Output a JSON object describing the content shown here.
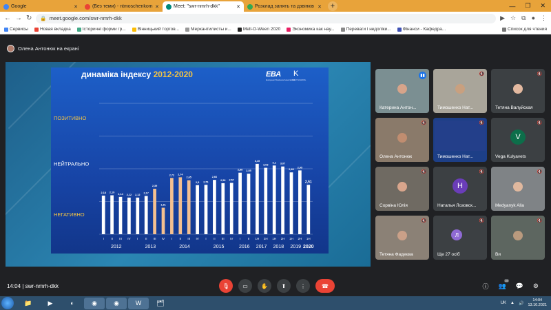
{
  "browser": {
    "tabs": [
      {
        "label": "Google",
        "color": "#4285f4",
        "active": false
      },
      {
        "label": "(Без теми) - ntmoschenkom@...",
        "color": "#ea4335",
        "active": false
      },
      {
        "label": "Meet: \"swr-nmrh-dkk\"",
        "color": "#00897b",
        "active": true
      },
      {
        "label": "Розклад занять та дзвінків | \"Е...",
        "color": "#34a853",
        "active": false
      }
    ],
    "new_tab": "+",
    "url": "meet.google.com/swr-nmrh-dkk",
    "bookmarks": [
      "Сервисы",
      "Новая вкладка",
      "Історичні форми гр...",
      "Вінницький торгов...",
      "Меркантилисты и...",
      "Mell-O-Ween 2020",
      "Экономика как нау...",
      "Переваги і недоліки...",
      "Фінанси - Кафедра..."
    ],
    "reading_list": "Список для чтения"
  },
  "meet": {
    "presenter_label": "Олена Антонюк на екрані",
    "meeting_time": "14:04",
    "meeting_code": "swr-nmrh-dkk",
    "participants_count": "39",
    "end_call_color": "#ea4335",
    "accent": "#1a73e8"
  },
  "slide": {
    "title_main": "динаміка індексу",
    "title_years": "2012-2020",
    "logo_eba": "EBA",
    "logo_eba_sub": "European Business Association",
    "logo_k": "K",
    "logo_k_sub": "KIEV SCHOOL"
  },
  "chart_data": {
    "type": "bar",
    "bands": [
      "ПОЗИТИВНО",
      "НЕЙТРАЛЬНО",
      "НЕГАТИВНО"
    ],
    "categories": [
      "I",
      "II",
      "III",
      "IV",
      "I",
      "II",
      "III",
      "IV",
      "I",
      "II",
      "III",
      "IV",
      "I",
      "II",
      "III",
      "IV",
      "I",
      "II",
      "III",
      "IV",
      "1H",
      "2H",
      "1H",
      "2H",
      "1H",
      "2H",
      "1H",
      "2H",
      "1H",
      "2H",
      "1H"
    ],
    "values": [
      2.18,
      2.19,
      2.14,
      2.12,
      2.12,
      2.17,
      2.39,
      1.81,
      2.72,
      2.74,
      2.65,
      2.5,
      2.51,
      2.66,
      2.56,
      2.57,
      2.88,
      2.85,
      3.15,
      3.03,
      3.1,
      3.07,
      2.89,
      2.95,
      2.51
    ],
    "bar_categories": [
      "I",
      "II",
      "III",
      "IV",
      "I",
      "II",
      "III",
      "IV",
      "I",
      "II",
      "III",
      "IV",
      "I",
      "II",
      "III",
      "IV",
      "I",
      "II",
      "1H",
      "2H",
      "1H",
      "2H",
      "1H",
      "2H",
      "1H"
    ],
    "highlight_color": "#f4c090",
    "highlight_indices": [
      6,
      7,
      8,
      9,
      10
    ],
    "bar_color": "#ffffff",
    "last_label_color": "#f5c542",
    "years": [
      "2012",
      "2013",
      "2014",
      "2015",
      "2016",
      "2017",
      "2018",
      "2019",
      "2020"
    ],
    "ylim": [
      1,
      5
    ]
  },
  "tiles": [
    {
      "name": "Катерина Антон...",
      "kind": "photo",
      "speaking": true
    },
    {
      "name": "Тимошенко Нат...",
      "kind": "photo",
      "speaking": false
    },
    {
      "name": "Тетяна Валуйская",
      "kind": "photo",
      "speaking": false
    },
    {
      "name": "Олена Антонюк",
      "kind": "photo",
      "speaking": false
    },
    {
      "name": "Тимошенко Нат...",
      "kind": "screen",
      "speaking": false
    },
    {
      "name": "Vega Kulyavets",
      "kind": "letter",
      "letter": "V",
      "color": "#0d6e4a"
    },
    {
      "name": "Сорвіна Юлія",
      "kind": "photo",
      "speaking": false
    },
    {
      "name": "Наталья Лозовск...",
      "kind": "letter",
      "letter": "Н",
      "color": "#6a3db8"
    },
    {
      "name": "Medyanyk Alla",
      "kind": "photo",
      "speaking": false
    },
    {
      "name": "Тетяна Фадеєва",
      "kind": "photo",
      "speaking": false
    },
    {
      "name": "Ще 27 осіб",
      "kind": "more",
      "letter": "Л",
      "color": "#8f6ad4"
    },
    {
      "name": "Ви",
      "kind": "photo",
      "speaking": false
    }
  ],
  "taskbar": {
    "lang": "UK",
    "time": "14:04",
    "date": "13.10.2021"
  }
}
